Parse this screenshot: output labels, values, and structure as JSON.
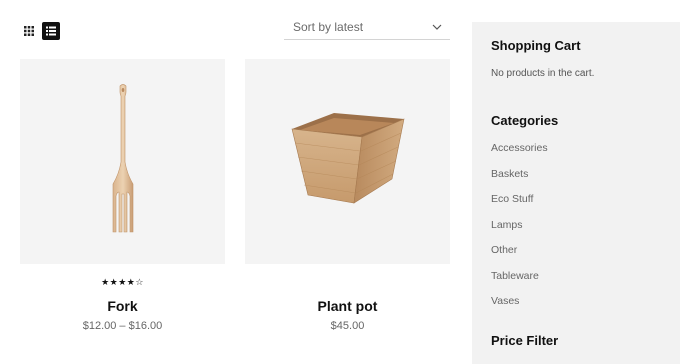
{
  "toolbar": {
    "grid_view_icon": "grid-icon",
    "list_view_icon": "list-icon",
    "sort_label": "Sort by latest"
  },
  "products": [
    {
      "title": "Fork",
      "price": "$12.00 – $16.00",
      "rating": 4,
      "rating_max": 5,
      "image_icon": "wooden-fork-image"
    },
    {
      "title": "Plant pot",
      "price": "$45.00",
      "image_icon": "wooden-planter-image"
    }
  ],
  "sidebar": {
    "cart_title": "Shopping Cart",
    "cart_empty": "No products in the cart.",
    "categories_title": "Categories",
    "categories": [
      "Accessories",
      "Baskets",
      "Eco Stuff",
      "Lamps",
      "Other",
      "Tableware",
      "Vases"
    ],
    "price_filter_title": "Price Filter"
  },
  "colors": {
    "accent": "#111111",
    "thumb_bg": "#f4f4f4",
    "sidebar_bg": "#f2f2f2"
  }
}
